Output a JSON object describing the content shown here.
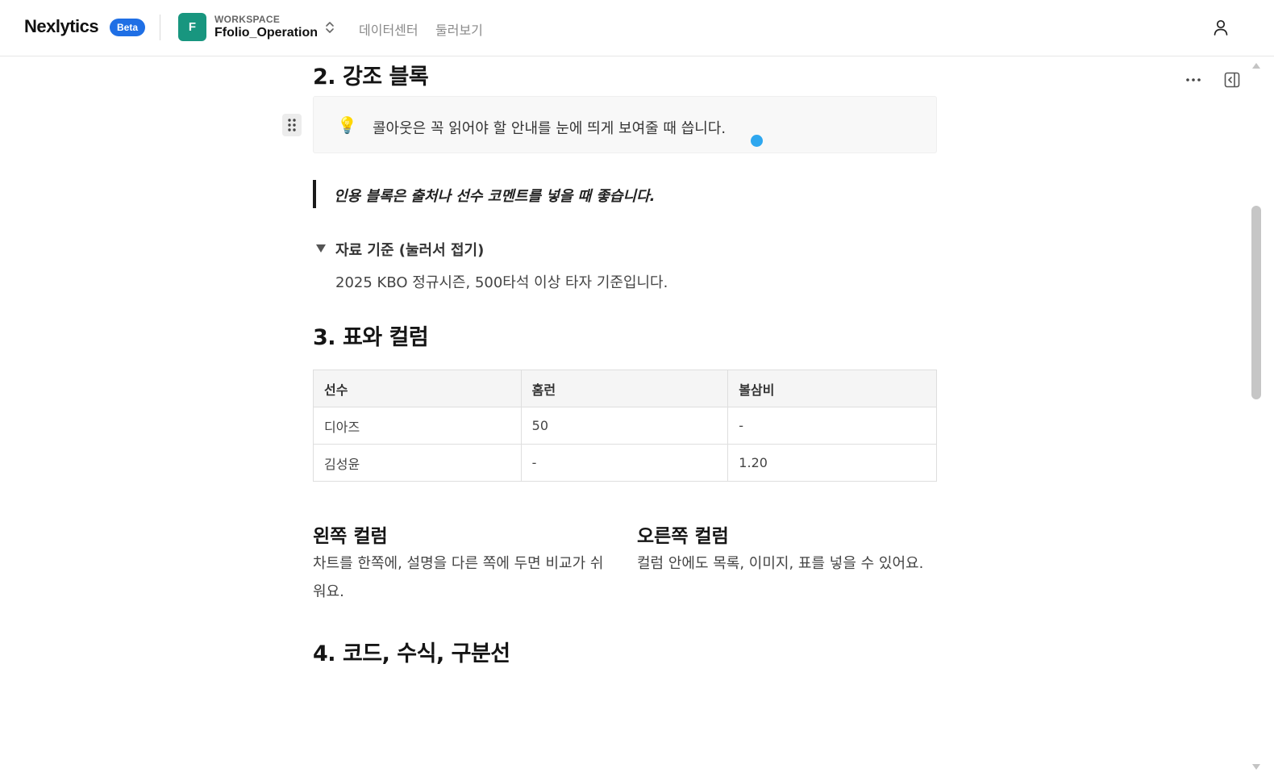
{
  "header": {
    "brand": "Nexlytics",
    "badge": "Beta",
    "workspace_caption": "WORKSPACE",
    "workspace_initial": "F",
    "workspace_name": "Ffolio_Operation",
    "nav": [
      "데이터센터",
      "둘러보기"
    ]
  },
  "colors": {
    "brand_badge": "#1f6fe5",
    "workspace_avatar": "#18967f",
    "caret": "#2ea7ef"
  },
  "icons": {
    "workspace_switch": "chevron-up-down-icon",
    "user": "user-icon",
    "more": "more-horizontal-icon",
    "panel": "sidebar-toggle-icon",
    "drag": "drag-handle-icon",
    "callout": "lightbulb-icon",
    "toggle": "triangle-down-icon"
  },
  "document": {
    "section2_title": "2. 강조 블록",
    "callout_emoji": "💡",
    "callout_text": "콜아웃은 꼭 읽어야 할 안내를 눈에 띄게 보여줄 때 씁니다.",
    "quote_text": "인용 블록은 출처나 선수 코멘트를 넣을 때 좋습니다.",
    "toggle_title": "자료 기준 (눌러서 접기)",
    "toggle_body": "2025 KBO 정규시즌, 500타석 이상 타자 기준입니다.",
    "section3_title": "3. 표와 컬럼",
    "table": {
      "headers": [
        "선수",
        "홈런",
        "볼삼비"
      ],
      "rows": [
        [
          "디아즈",
          "50",
          "-"
        ],
        [
          "김성윤",
          "-",
          "1.20"
        ]
      ]
    },
    "left_column": {
      "title": "왼쪽 컬럼",
      "body": "차트를 한쪽에, 설명을 다른 쪽에 두면 비교가 쉬워요."
    },
    "right_column": {
      "title": "오른쪽 컬럼",
      "body": "컬럼 안에도 목록, 이미지, 표를 넣을 수 있어요."
    },
    "section4_title": "4. 코드, 수식, 구분선"
  }
}
